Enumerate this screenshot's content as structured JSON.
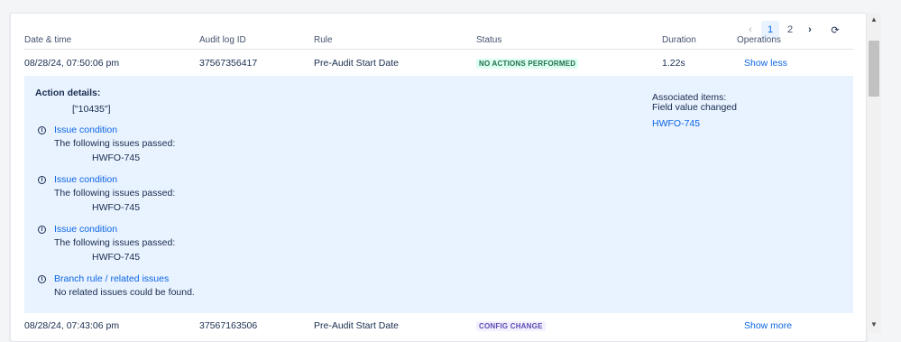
{
  "pagination": {
    "prev_icon": "‹",
    "pages": [
      "1",
      "2"
    ],
    "current_page": "1",
    "next_icon": "›",
    "refresh_icon": "⟳"
  },
  "columns": {
    "datetime": "Date & time",
    "audit_id": "Audit log ID",
    "rule": "Rule",
    "status": "Status",
    "duration": "Duration",
    "operations": "Operations"
  },
  "rows": [
    {
      "datetime": "08/28/24, 07:50:06 pm",
      "audit_id": "37567356417",
      "rule": "Pre-Audit Start Date",
      "status": "NO ACTIONS PERFORMED",
      "duration": "1.22s",
      "operation": "Show less"
    },
    {
      "datetime": "08/28/24, 07:43:06 pm",
      "audit_id": "37567163506",
      "rule": "Pre-Audit Start Date",
      "status": "CONFIG CHANGE",
      "duration": "",
      "operation": "Show more"
    }
  ],
  "details": {
    "action_title": "Action details:",
    "action_value": "[\"10435\"]",
    "conditions": [
      {
        "title": "Issue condition",
        "text": "The following issues passed:",
        "issue": "HWFO-745"
      },
      {
        "title": "Issue condition",
        "text": "The following issues passed:",
        "issue": "HWFO-745"
      },
      {
        "title": "Issue condition",
        "text": "The following issues passed:",
        "issue": "HWFO-745"
      }
    ],
    "branch": {
      "title": "Branch rule / related issues",
      "text": "No related issues could be found."
    },
    "associated": {
      "title": "Associated items:",
      "subtitle": "Field value changed",
      "link": "HWFO-745"
    }
  },
  "scrollbar": {
    "up_icon": "▲",
    "down_icon": "▼"
  }
}
